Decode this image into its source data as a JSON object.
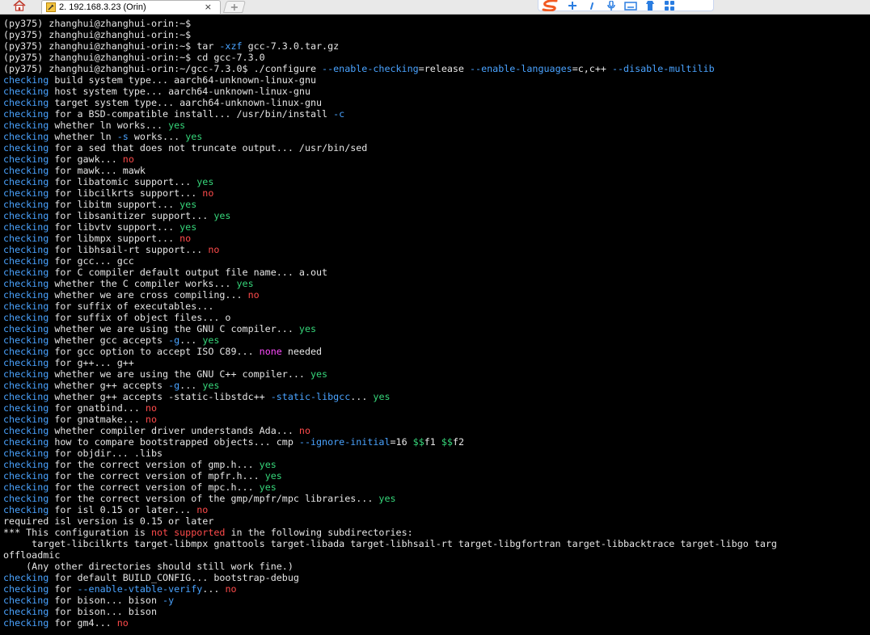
{
  "window": {
    "tab_title": "2. 192.168.3.23 (Orin)",
    "tab_close": "×"
  },
  "colors": {
    "background": "#000000",
    "text": "#e6e6e6",
    "keyword_blue": "#4aa3ff",
    "yes_green": "#36d67a",
    "no_red": "#ff4b4b",
    "none_magenta": "#ff4bff"
  },
  "icons": {
    "home": "home-icon",
    "terminal_tab": "terminal-icon",
    "new_tab": "plus-icon",
    "ime_logo": "sogou-ime-icon",
    "ime_tools": [
      "pinyin-plus-icon",
      "punctuation-icon",
      "microphone-icon",
      "keyboard-icon",
      "skin-icon",
      "toolbox-icon"
    ]
  },
  "terminal": {
    "lines": [
      [
        {
          "t": "(py375) zhanghui@zhanghui-orin:~$",
          "c": "p"
        }
      ],
      [
        {
          "t": "(py375) zhanghui@zhanghui-orin:~$",
          "c": "p"
        }
      ],
      [
        {
          "t": "(py375) zhanghui@zhanghui-orin:~$ tar ",
          "c": "p"
        },
        {
          "t": "-xzf",
          "c": "opt"
        },
        {
          "t": " gcc-7.3.0.tar.gz",
          "c": "p"
        }
      ],
      [
        {
          "t": "(py375) zhanghui@zhanghui-orin:~$ cd gcc-7.3.0",
          "c": "p"
        }
      ],
      [
        {
          "t": "(py375) zhanghui@zhanghui-orin:~/gcc-7.3.0$ ./configure ",
          "c": "p"
        },
        {
          "t": "--enable-checking",
          "c": "opt"
        },
        {
          "t": "=release ",
          "c": "p"
        },
        {
          "t": "--enable-languages",
          "c": "opt"
        },
        {
          "t": "=c,c++ ",
          "c": "p"
        },
        {
          "t": "--disable-multilib",
          "c": "opt"
        }
      ],
      [
        {
          "t": "checking",
          "c": "c"
        },
        {
          "t": " build system type... aarch64-unknown-linux-gnu",
          "c": "p"
        }
      ],
      [
        {
          "t": "checking",
          "c": "c"
        },
        {
          "t": " host system type... aarch64-unknown-linux-gnu",
          "c": "p"
        }
      ],
      [
        {
          "t": "checking",
          "c": "c"
        },
        {
          "t": " target system type... aarch64-unknown-linux-gnu",
          "c": "p"
        }
      ],
      [
        {
          "t": "checking",
          "c": "c"
        },
        {
          "t": " for a BSD-compatible install... /usr/bin/install ",
          "c": "p"
        },
        {
          "t": "-c",
          "c": "opt"
        }
      ],
      [
        {
          "t": "checking",
          "c": "c"
        },
        {
          "t": " whether ln works... ",
          "c": "p"
        },
        {
          "t": "yes",
          "c": "y"
        }
      ],
      [
        {
          "t": "checking",
          "c": "c"
        },
        {
          "t": " whether ln ",
          "c": "p"
        },
        {
          "t": "-s",
          "c": "opt"
        },
        {
          "t": " works... ",
          "c": "p"
        },
        {
          "t": "yes",
          "c": "y"
        }
      ],
      [
        {
          "t": "checking",
          "c": "c"
        },
        {
          "t": " for a sed that does not truncate output... /usr/bin/sed",
          "c": "p"
        }
      ],
      [
        {
          "t": "checking",
          "c": "c"
        },
        {
          "t": " for gawk... ",
          "c": "p"
        },
        {
          "t": "no",
          "c": "n"
        }
      ],
      [
        {
          "t": "checking",
          "c": "c"
        },
        {
          "t": " for mawk... mawk",
          "c": "p"
        }
      ],
      [
        {
          "t": "checking",
          "c": "c"
        },
        {
          "t": " for libatomic support... ",
          "c": "p"
        },
        {
          "t": "yes",
          "c": "y"
        }
      ],
      [
        {
          "t": "checking",
          "c": "c"
        },
        {
          "t": " for libcilkrts support... ",
          "c": "p"
        },
        {
          "t": "no",
          "c": "n"
        }
      ],
      [
        {
          "t": "checking",
          "c": "c"
        },
        {
          "t": " for libitm support... ",
          "c": "p"
        },
        {
          "t": "yes",
          "c": "y"
        }
      ],
      [
        {
          "t": "checking",
          "c": "c"
        },
        {
          "t": " for libsanitizer support... ",
          "c": "p"
        },
        {
          "t": "yes",
          "c": "y"
        }
      ],
      [
        {
          "t": "checking",
          "c": "c"
        },
        {
          "t": " for libvtv support... ",
          "c": "p"
        },
        {
          "t": "yes",
          "c": "y"
        }
      ],
      [
        {
          "t": "checking",
          "c": "c"
        },
        {
          "t": " for libmpx support... ",
          "c": "p"
        },
        {
          "t": "no",
          "c": "n"
        }
      ],
      [
        {
          "t": "checking",
          "c": "c"
        },
        {
          "t": " for libhsail-rt support... ",
          "c": "p"
        },
        {
          "t": "no",
          "c": "n"
        }
      ],
      [
        {
          "t": "checking",
          "c": "c"
        },
        {
          "t": " for gcc... gcc",
          "c": "p"
        }
      ],
      [
        {
          "t": "checking",
          "c": "c"
        },
        {
          "t": " for C compiler default output file name... a.out",
          "c": "p"
        }
      ],
      [
        {
          "t": "checking",
          "c": "c"
        },
        {
          "t": " whether the C compiler works... ",
          "c": "p"
        },
        {
          "t": "yes",
          "c": "y"
        }
      ],
      [
        {
          "t": "checking",
          "c": "c"
        },
        {
          "t": " whether we are cross compiling... ",
          "c": "p"
        },
        {
          "t": "no",
          "c": "n"
        }
      ],
      [
        {
          "t": "checking",
          "c": "c"
        },
        {
          "t": " for suffix of executables...",
          "c": "p"
        }
      ],
      [
        {
          "t": "checking",
          "c": "c"
        },
        {
          "t": " for suffix of object files... o",
          "c": "p"
        }
      ],
      [
        {
          "t": "checking",
          "c": "c"
        },
        {
          "t": " whether we are using the GNU C compiler... ",
          "c": "p"
        },
        {
          "t": "yes",
          "c": "y"
        }
      ],
      [
        {
          "t": "checking",
          "c": "c"
        },
        {
          "t": " whether gcc accepts ",
          "c": "p"
        },
        {
          "t": "-g",
          "c": "opt"
        },
        {
          "t": "... ",
          "c": "p"
        },
        {
          "t": "yes",
          "c": "y"
        }
      ],
      [
        {
          "t": "checking",
          "c": "c"
        },
        {
          "t": " for gcc option to accept ISO C89... ",
          "c": "p"
        },
        {
          "t": "none",
          "c": "m"
        },
        {
          "t": " needed",
          "c": "p"
        }
      ],
      [
        {
          "t": "checking",
          "c": "c"
        },
        {
          "t": " for g++... g++",
          "c": "p"
        }
      ],
      [
        {
          "t": "checking",
          "c": "c"
        },
        {
          "t": " whether we are using the GNU C++ compiler... ",
          "c": "p"
        },
        {
          "t": "yes",
          "c": "y"
        }
      ],
      [
        {
          "t": "checking",
          "c": "c"
        },
        {
          "t": " whether g++ accepts ",
          "c": "p"
        },
        {
          "t": "-g",
          "c": "opt"
        },
        {
          "t": "... ",
          "c": "p"
        },
        {
          "t": "yes",
          "c": "y"
        }
      ],
      [
        {
          "t": "checking",
          "c": "c"
        },
        {
          "t": " whether g++ accepts -static-libstdc++ ",
          "c": "p"
        },
        {
          "t": "-static-libgcc",
          "c": "opt"
        },
        {
          "t": "... ",
          "c": "p"
        },
        {
          "t": "yes",
          "c": "y"
        }
      ],
      [
        {
          "t": "checking",
          "c": "c"
        },
        {
          "t": " for gnatbind... ",
          "c": "p"
        },
        {
          "t": "no",
          "c": "n"
        }
      ],
      [
        {
          "t": "checking",
          "c": "c"
        },
        {
          "t": " for gnatmake... ",
          "c": "p"
        },
        {
          "t": "no",
          "c": "n"
        }
      ],
      [
        {
          "t": "checking",
          "c": "c"
        },
        {
          "t": " whether compiler driver understands Ada... ",
          "c": "p"
        },
        {
          "t": "no",
          "c": "n"
        }
      ],
      [
        {
          "t": "checking",
          "c": "c"
        },
        {
          "t": " how to compare bootstrapped objects... cmp ",
          "c": "p"
        },
        {
          "t": "--ignore-initial",
          "c": "opt"
        },
        {
          "t": "=16 ",
          "c": "p"
        },
        {
          "t": "$$",
          "c": "y"
        },
        {
          "t": "f1 ",
          "c": "p"
        },
        {
          "t": "$$",
          "c": "y"
        },
        {
          "t": "f2",
          "c": "p"
        }
      ],
      [
        {
          "t": "checking",
          "c": "c"
        },
        {
          "t": " for objdir... .libs",
          "c": "p"
        }
      ],
      [
        {
          "t": "checking",
          "c": "c"
        },
        {
          "t": " for the correct version of gmp.h... ",
          "c": "p"
        },
        {
          "t": "yes",
          "c": "y"
        }
      ],
      [
        {
          "t": "checking",
          "c": "c"
        },
        {
          "t": " for the correct version of mpfr.h... ",
          "c": "p"
        },
        {
          "t": "yes",
          "c": "y"
        }
      ],
      [
        {
          "t": "checking",
          "c": "c"
        },
        {
          "t": " for the correct version of mpc.h... ",
          "c": "p"
        },
        {
          "t": "yes",
          "c": "y"
        }
      ],
      [
        {
          "t": "checking",
          "c": "c"
        },
        {
          "t": " for the correct version of the gmp/mpfr/mpc libraries... ",
          "c": "p"
        },
        {
          "t": "yes",
          "c": "y"
        }
      ],
      [
        {
          "t": "checking",
          "c": "c"
        },
        {
          "t": " for isl 0.15 or later... ",
          "c": "p"
        },
        {
          "t": "no",
          "c": "n"
        }
      ],
      [
        {
          "t": "required isl version is 0.15 or later",
          "c": "p"
        }
      ],
      [
        {
          "t": "*** This configuration is ",
          "c": "p"
        },
        {
          "t": "not supported",
          "c": "n"
        },
        {
          "t": " in the following subdirectories:",
          "c": "p"
        }
      ],
      [
        {
          "t": "     target-libcilkrts target-libmpx gnattools target-libada target-libhsail-rt target-libgfortran target-libbacktrace target-libgo targ",
          "c": "p"
        }
      ],
      [
        {
          "t": "offloadmic",
          "c": "p"
        }
      ],
      [
        {
          "t": "    (Any other directories should still work fine.)",
          "c": "p"
        }
      ],
      [
        {
          "t": "checking",
          "c": "c"
        },
        {
          "t": " for default BUILD_CONFIG... bootstrap-debug",
          "c": "p"
        }
      ],
      [
        {
          "t": "checking",
          "c": "c"
        },
        {
          "t": " for ",
          "c": "p"
        },
        {
          "t": "--enable-vtable-verify",
          "c": "opt"
        },
        {
          "t": "... ",
          "c": "p"
        },
        {
          "t": "no",
          "c": "n"
        }
      ],
      [
        {
          "t": "checking",
          "c": "c"
        },
        {
          "t": " for bison... bison ",
          "c": "p"
        },
        {
          "t": "-y",
          "c": "opt"
        }
      ],
      [
        {
          "t": "checking",
          "c": "c"
        },
        {
          "t": " for bison... bison",
          "c": "p"
        }
      ],
      [
        {
          "t": "checking",
          "c": "c"
        },
        {
          "t": " for gm4... ",
          "c": "p"
        },
        {
          "t": "no",
          "c": "n"
        }
      ]
    ]
  }
}
